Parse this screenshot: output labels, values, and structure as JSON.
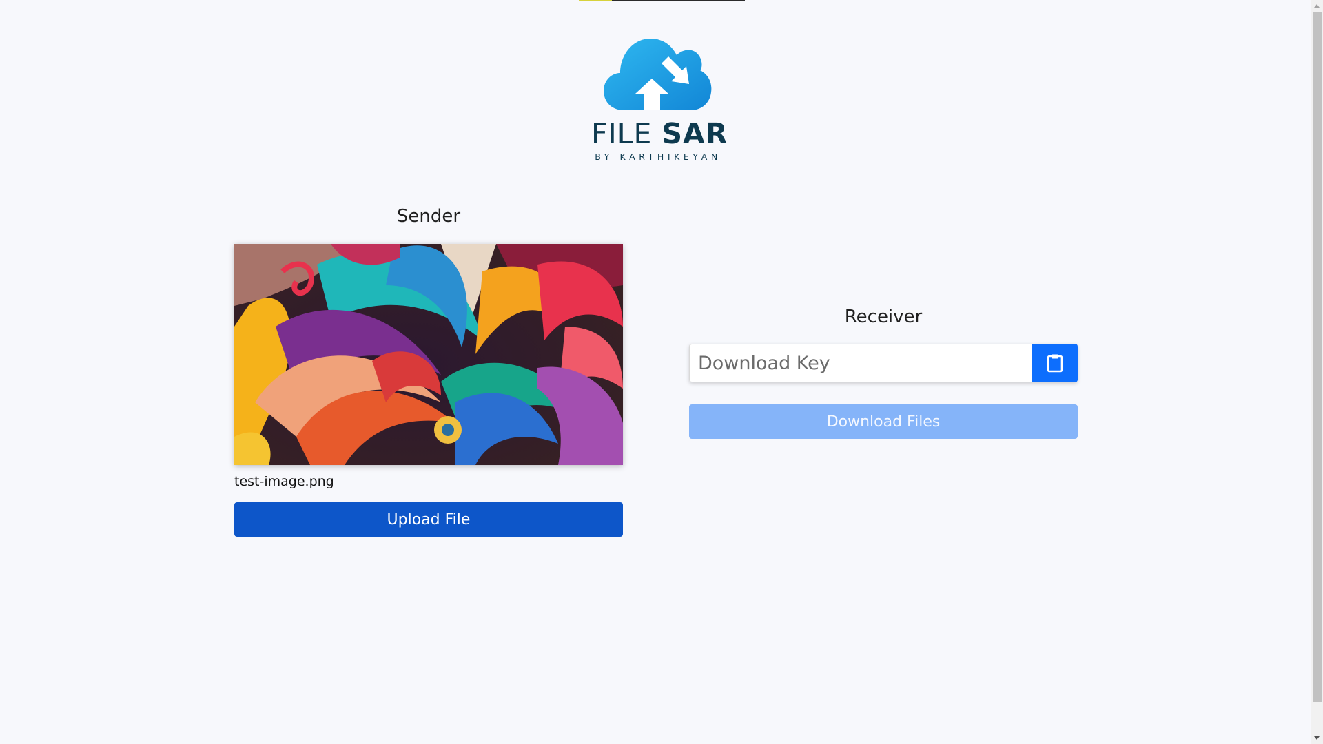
{
  "logo": {
    "brand_light": "FILE",
    "brand_bold": "SAR",
    "byline": "BY KARTHIKEYAN"
  },
  "sender": {
    "title": "Sender",
    "file_name": "test-image.png",
    "upload_label": "Upload File"
  },
  "receiver": {
    "title": "Receiver",
    "key_placeholder": "Download Key",
    "key_value": "",
    "paste_icon": "clipboard-icon",
    "download_label": "Download Files"
  },
  "colors": {
    "background": "#f7f8fc",
    "primary": "#0d6efd",
    "upload_button": "#0d56c9",
    "download_button_disabled": "#85b4f9",
    "brand_dark": "#0e3a4f",
    "cloud_blue": "#1aa3e8"
  }
}
